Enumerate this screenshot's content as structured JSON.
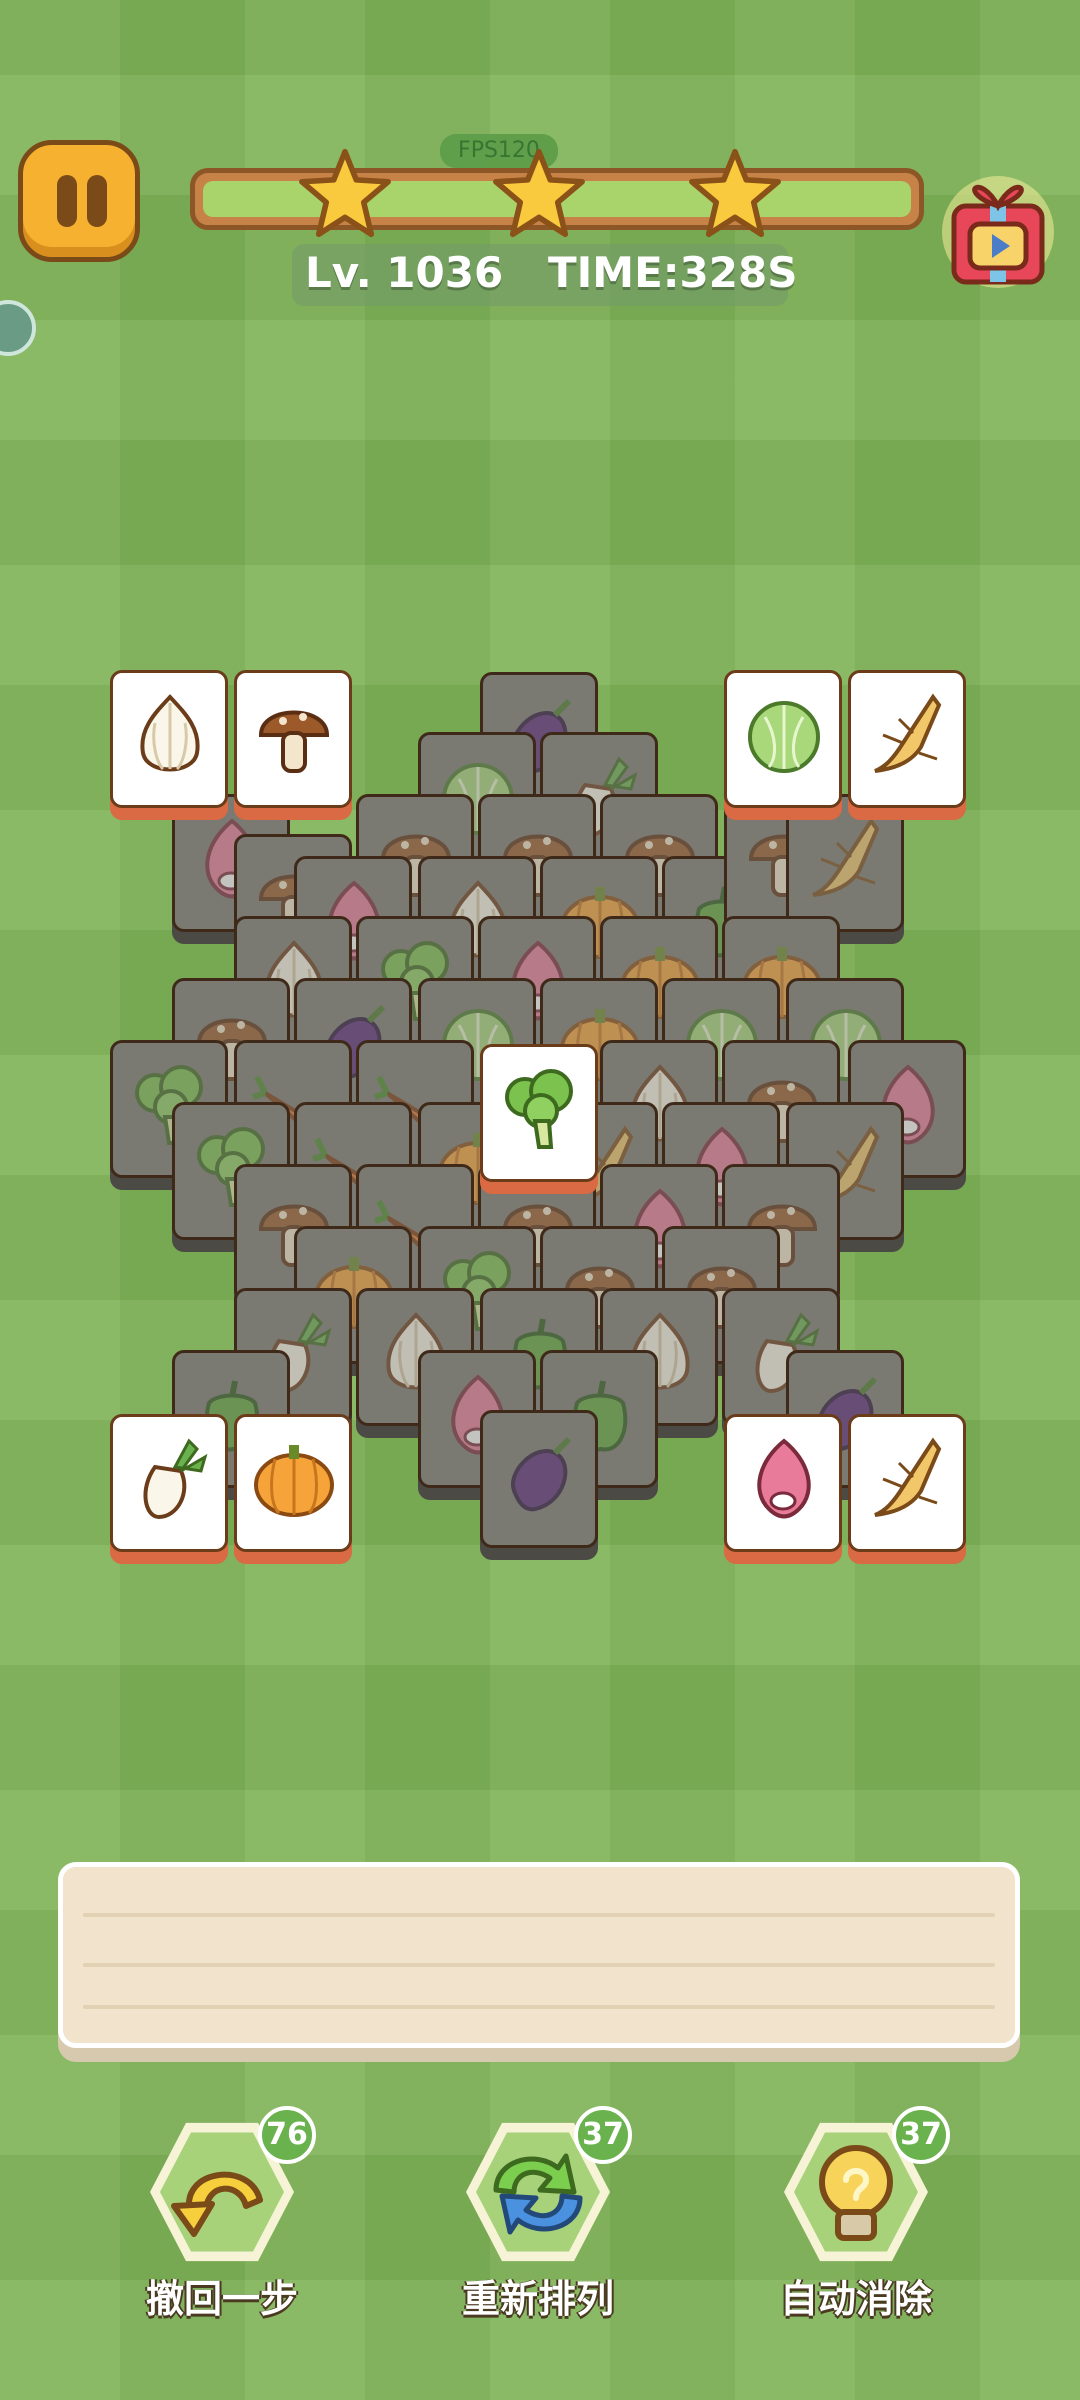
{
  "hud": {
    "fps": "FPS120",
    "level": "Lv. 1036",
    "time": "TIME:328S",
    "stars": 3,
    "progress": 1.0
  },
  "icons": {
    "pause": "pause-icon",
    "gift": "gift-video-icon",
    "star": "star-icon"
  },
  "board": {
    "free_tiles": [
      "garlic",
      "mushroom",
      "cabbage",
      "ginseng",
      "broccoli",
      "radish",
      "pumpkin",
      "onion",
      "ginseng"
    ],
    "tile_types": [
      "garlic",
      "mushroom",
      "cabbage",
      "ginseng",
      "broccoli",
      "radish",
      "pumpkin",
      "onion",
      "eggplant",
      "carrot",
      "pepper"
    ]
  },
  "tray": {
    "slots_filled": 0
  },
  "tools": [
    {
      "label": "撤回一步",
      "count": "76",
      "icon": "undo-icon"
    },
    {
      "label": "重新排列",
      "count": "37",
      "icon": "shuffle-icon"
    },
    {
      "label": "自动消除",
      "count": "37",
      "icon": "lightbulb-hint-icon"
    }
  ],
  "colors": {
    "background": "#7fb357",
    "tile_face": "#ffffff",
    "tile_edge": "#d96a43",
    "tile_dim": "#7a7a73",
    "accent_gold": "#f5b12f",
    "progress_fill": "#a9d36b"
  }
}
